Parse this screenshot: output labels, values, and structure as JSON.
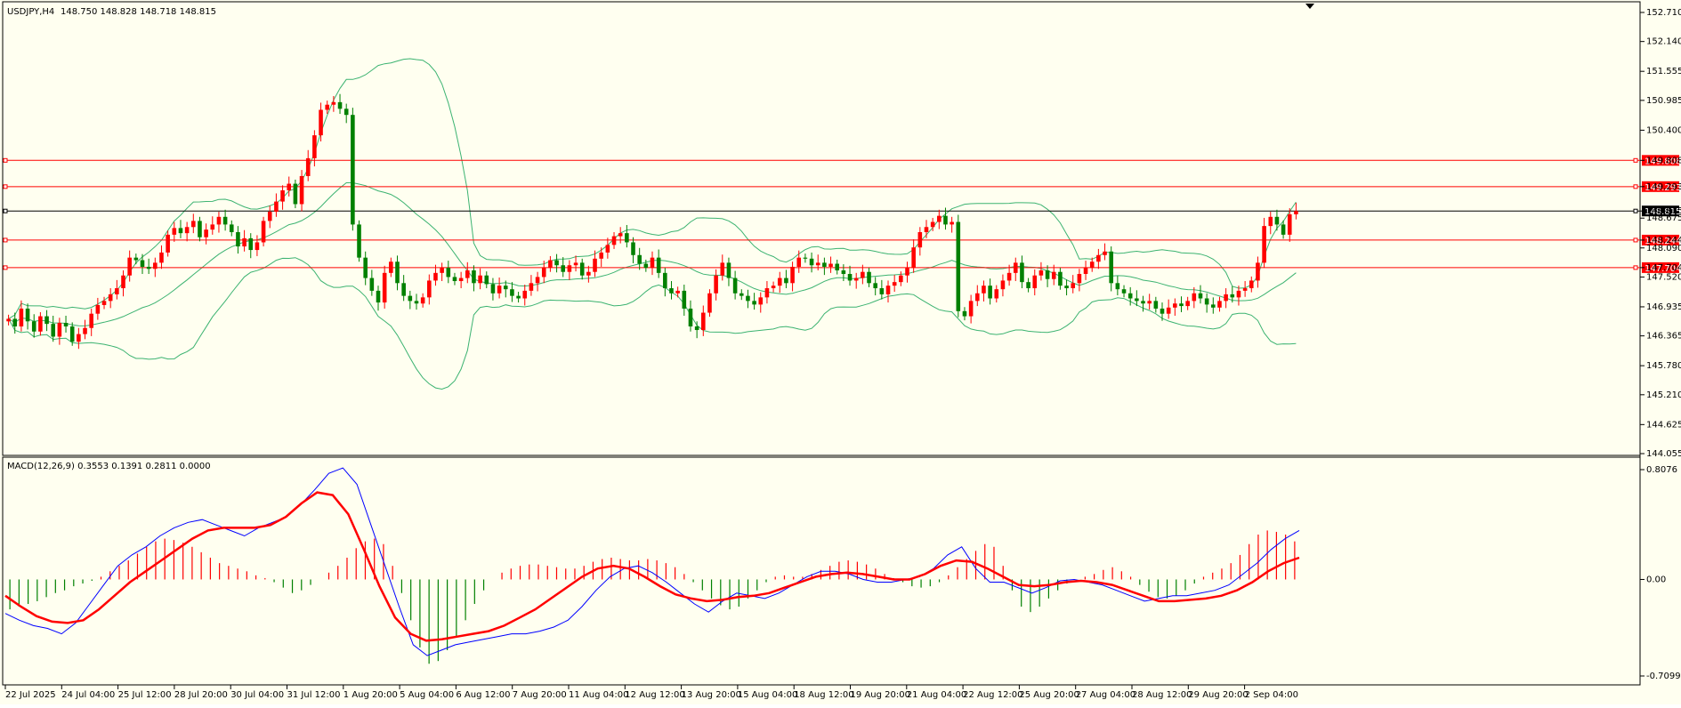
{
  "header": {
    "symbol": "USDJPY,H4",
    "ohlc": "148.750 148.828 148.718 148.815"
  },
  "colors": {
    "background": "#fffff0",
    "bull": "#ff0000",
    "bear": "#008000",
    "bollinger": "#3cb371",
    "level_line": "#ff0000",
    "current_line": "#000000",
    "macd_line": "#0000ff",
    "signal_line": "#ff0000",
    "hist_pos": "#ff0000",
    "hist_neg": "#008000"
  },
  "chart_data": [
    {
      "type": "candlestick",
      "title": "USDJPY,H4",
      "price_axis_ticks": [
        "152.710",
        "152.140",
        "151.555",
        "150.985",
        "150.400",
        "149.808",
        "149.293",
        "148.815",
        "148.675",
        "148.244",
        "148.090",
        "147.704",
        "147.520",
        "146.935",
        "146.365",
        "145.780",
        "145.210",
        "144.625",
        "144.055"
      ],
      "ylim": [
        144.055,
        152.71
      ],
      "highlighted_levels": [
        {
          "label": "149.808",
          "value": 149.808,
          "style": "red-box"
        },
        {
          "label": "149.293",
          "value": 149.293,
          "style": "red-box"
        },
        {
          "label": "148.815",
          "value": 148.815,
          "style": "black-box"
        },
        {
          "label": "148.244",
          "value": 148.244,
          "style": "red-box"
        },
        {
          "label": "147.704",
          "value": 147.704,
          "style": "red-box"
        }
      ],
      "time_axis_labels": [
        "22 Jul 2025",
        "24 Jul 04:00",
        "25 Jul 12:00",
        "28 Jul 20:00",
        "30 Jul 04:00",
        "31 Jul 12:00",
        "1 Aug 20:00",
        "5 Aug 04:00",
        "6 Aug 12:00",
        "7 Aug 20:00",
        "11 Aug 04:00",
        "12 Aug 12:00",
        "13 Aug 20:00",
        "15 Aug 04:00",
        "18 Aug 12:00",
        "19 Aug 20:00",
        "21 Aug 04:00",
        "22 Aug 12:00",
        "25 Aug 20:00",
        "27 Aug 04:00",
        "28 Aug 12:00",
        "29 Aug 20:00",
        "2 Sep 04:00"
      ],
      "close_series": [
        146.7,
        146.55,
        146.9,
        146.65,
        146.45,
        146.75,
        146.6,
        146.35,
        146.62,
        146.55,
        146.25,
        146.4,
        146.52,
        146.8,
        146.97,
        147.05,
        147.18,
        147.3,
        147.55,
        147.9,
        147.85,
        147.72,
        147.68,
        147.8,
        148.0,
        148.35,
        148.48,
        148.38,
        148.5,
        148.62,
        148.3,
        148.45,
        148.55,
        148.7,
        148.55,
        148.4,
        148.12,
        148.28,
        148.05,
        148.2,
        148.62,
        148.8,
        149.0,
        149.22,
        149.35,
        148.95,
        149.5,
        149.85,
        150.3,
        150.8,
        150.9,
        150.95,
        150.82,
        150.7,
        148.55,
        147.9,
        147.5,
        147.25,
        147.02,
        147.6,
        147.82,
        147.4,
        147.15,
        147.05,
        147.0,
        147.12,
        147.45,
        147.6,
        147.7,
        147.52,
        147.44,
        147.5,
        147.65,
        147.4,
        147.55,
        147.38,
        147.2,
        147.35,
        147.28,
        147.15,
        147.1,
        147.25,
        147.4,
        147.52,
        147.7,
        147.85,
        147.75,
        147.62,
        147.75,
        147.8,
        147.55,
        147.62,
        147.88,
        148.0,
        148.15,
        148.32,
        148.38,
        148.2,
        147.95,
        147.78,
        147.7,
        147.9,
        147.6,
        147.3,
        147.2,
        147.25,
        146.9,
        146.55,
        146.48,
        146.82,
        147.2,
        147.55,
        147.8,
        147.5,
        147.2,
        147.15,
        147.05,
        146.98,
        147.12,
        147.3,
        147.35,
        147.5,
        147.4,
        147.72,
        147.9,
        147.88,
        147.75,
        147.8,
        147.72,
        147.78,
        147.65,
        147.58,
        147.45,
        147.5,
        147.62,
        147.4,
        147.3,
        147.18,
        147.35,
        147.42,
        147.55,
        147.7,
        148.1,
        148.4,
        148.5,
        148.6,
        148.72,
        148.55,
        148.6,
        146.85,
        146.75,
        147.05,
        147.2,
        147.35,
        147.1,
        147.28,
        147.45,
        147.6,
        147.8,
        147.42,
        147.3,
        147.55,
        147.65,
        147.48,
        147.62,
        147.35,
        147.3,
        147.4,
        147.58,
        147.7,
        147.82,
        147.95,
        148.02,
        147.4,
        147.28,
        147.2,
        147.1,
        147.05,
        147.0,
        147.05,
        146.9,
        146.8,
        146.92,
        147.0,
        146.95,
        147.05,
        147.2,
        147.1,
        146.98,
        146.92,
        147.05,
        147.18,
        147.12,
        147.25,
        147.3,
        147.45,
        147.8,
        148.52,
        148.7,
        148.55,
        148.35,
        148.75,
        148.815
      ],
      "indicator": "Bollinger Bands"
    },
    {
      "type": "line",
      "title": "MACD(12,26,9) 0.3553 0.1391 0.2811 0.0000",
      "ylim": [
        -0.7099,
        0.8076
      ],
      "y_ticks": [
        "0.8076",
        "0.00",
        "-0.7099"
      ],
      "series": [
        {
          "name": "MACD(12,26,9)",
          "kind": "histogram",
          "values": [
            -0.22,
            -0.2,
            -0.18,
            -0.16,
            -0.13,
            -0.1,
            -0.08,
            -0.05,
            -0.03,
            -0.01,
            0.02,
            0.06,
            0.1,
            0.14,
            0.19,
            0.24,
            0.28,
            0.3,
            0.29,
            0.27,
            0.24,
            0.2,
            0.16,
            0.12,
            0.1,
            0.08,
            0.06,
            0.03,
            0.01,
            -0.02,
            -0.06,
            -0.1,
            -0.08,
            -0.04,
            0.0,
            0.05,
            0.1,
            0.16,
            0.23,
            0.28,
            0.3,
            0.26,
            0.1,
            -0.1,
            -0.3,
            -0.5,
            -0.62,
            -0.6,
            -0.52,
            -0.42,
            -0.3,
            -0.18,
            -0.08,
            0.0,
            0.05,
            0.08,
            0.1,
            0.11,
            0.11,
            0.1,
            0.09,
            0.08,
            0.08,
            0.1,
            0.13,
            0.15,
            0.16,
            0.15,
            0.14,
            0.14,
            0.15,
            0.14,
            0.12,
            0.09,
            0.04,
            -0.02,
            -0.08,
            -0.14,
            -0.19,
            -0.22,
            -0.2,
            -0.14,
            -0.08,
            -0.02,
            0.02,
            0.03,
            0.02,
            0.02,
            0.04,
            0.07,
            0.1,
            0.13,
            0.14,
            0.13,
            0.11,
            0.08,
            0.04,
            0.01,
            -0.02,
            -0.05,
            -0.06,
            -0.05,
            -0.02,
            0.03,
            0.09,
            0.15,
            0.21,
            0.26,
            0.24,
            0.1,
            -0.08,
            -0.2,
            -0.24,
            -0.2,
            -0.14,
            -0.08,
            -0.03,
            0.0,
            0.02,
            0.04,
            0.07,
            0.09,
            0.06,
            0.02,
            -0.04,
            -0.09,
            -0.13,
            -0.14,
            -0.12,
            -0.08,
            -0.03,
            0.02,
            0.05,
            0.08,
            0.12,
            0.18,
            0.26,
            0.33,
            0.36,
            0.35,
            0.33,
            0.28
          ]
        },
        {
          "name": "MACD line",
          "kind": "line",
          "values": [
            -0.25,
            -0.3,
            -0.34,
            -0.36,
            -0.4,
            -0.32,
            -0.18,
            -0.04,
            0.1,
            0.18,
            0.24,
            0.32,
            0.38,
            0.42,
            0.44,
            0.4,
            0.36,
            0.32,
            0.38,
            0.42,
            0.46,
            0.55,
            0.66,
            0.78,
            0.82,
            0.7,
            0.4,
            0.1,
            -0.2,
            -0.48,
            -0.56,
            -0.52,
            -0.48,
            -0.46,
            -0.44,
            -0.42,
            -0.4,
            -0.4,
            -0.38,
            -0.35,
            -0.3,
            -0.2,
            -0.08,
            0.02,
            0.08,
            0.1,
            0.05,
            -0.02,
            -0.1,
            -0.18,
            -0.24,
            -0.16,
            -0.1,
            -0.12,
            -0.14,
            -0.1,
            -0.04,
            0.02,
            0.06,
            0.06,
            0.04,
            0.0,
            -0.02,
            -0.02,
            0.0,
            0.02,
            0.08,
            0.18,
            0.24,
            0.08,
            -0.02,
            -0.02,
            -0.06,
            -0.1,
            -0.06,
            -0.01,
            0.0,
            -0.02,
            -0.04,
            -0.08,
            -0.12,
            -0.16,
            -0.14,
            -0.12,
            -0.12,
            -0.1,
            -0.08,
            -0.04,
            0.04,
            0.12,
            0.22,
            0.3,
            0.36
          ]
        },
        {
          "name": "Signal line",
          "kind": "line",
          "values": [
            -0.12,
            -0.2,
            -0.27,
            -0.31,
            -0.32,
            -0.3,
            -0.22,
            -0.12,
            -0.02,
            0.06,
            0.14,
            0.22,
            0.3,
            0.36,
            0.38,
            0.38,
            0.38,
            0.4,
            0.46,
            0.56,
            0.64,
            0.62,
            0.48,
            0.22,
            -0.05,
            -0.28,
            -0.4,
            -0.45,
            -0.44,
            -0.42,
            -0.4,
            -0.38,
            -0.34,
            -0.28,
            -0.22,
            -0.14,
            -0.06,
            0.02,
            0.08,
            0.1,
            0.08,
            0.02,
            -0.05,
            -0.11,
            -0.14,
            -0.16,
            -0.15,
            -0.13,
            -0.12,
            -0.1,
            -0.06,
            -0.02,
            0.02,
            0.04,
            0.05,
            0.04,
            0.02,
            0.0,
            0.0,
            0.04,
            0.1,
            0.14,
            0.13,
            0.08,
            0.02,
            -0.04,
            -0.05,
            -0.04,
            -0.02,
            -0.01,
            -0.02,
            -0.04,
            -0.08,
            -0.12,
            -0.16,
            -0.16,
            -0.15,
            -0.14,
            -0.12,
            -0.08,
            -0.02,
            0.06,
            0.12,
            0.16
          ]
        }
      ]
    }
  ]
}
